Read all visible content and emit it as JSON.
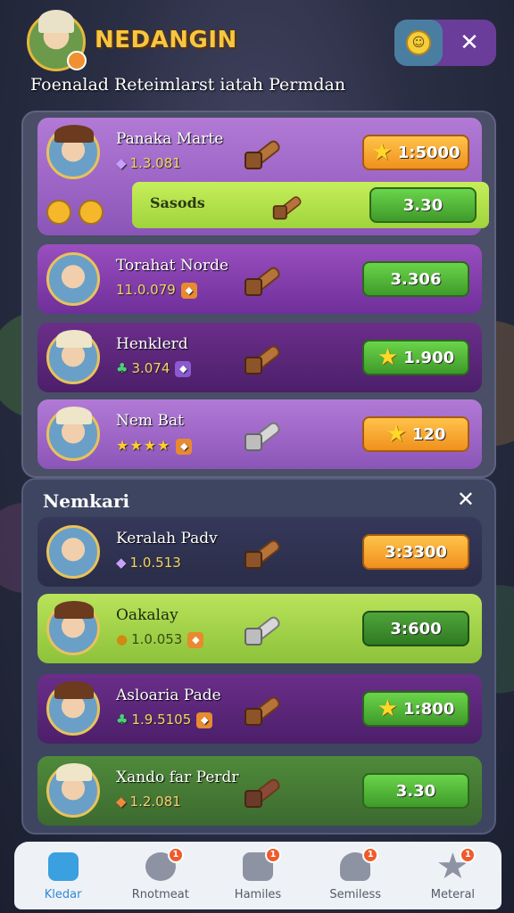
{
  "header": {
    "title": "NEDANGIN",
    "subtitle": "Foenalad Reteimlarst iatah Permdan"
  },
  "top_controls": {
    "close_label": "✕"
  },
  "featured": {
    "name": "Panaka Marte",
    "sub": "1.3.081",
    "button": "1:5000",
    "subrow_label": "Sasods",
    "subrow_button": "3.30"
  },
  "list_a": [
    {
      "name": "Torahat Norde",
      "sub": "11.0.079",
      "button": "3.306",
      "button_style": "green"
    },
    {
      "name": "Henklerd",
      "sub": "3.074",
      "button": "1.900",
      "button_style": "green"
    },
    {
      "name": "Nem Bat",
      "sub": "★★★★",
      "button": "120",
      "button_style": "orange"
    }
  ],
  "section": {
    "title": "Nemkari",
    "close_label": "✕"
  },
  "list_b": [
    {
      "name": "Keralah Padv",
      "sub": "1.0.513",
      "button": "3:3300",
      "button_style": "orange"
    },
    {
      "name": "Oakalay",
      "sub": "1.0.053",
      "button": "3:600",
      "button_style": "dgreen"
    },
    {
      "name": "Asloaria Pade",
      "sub": "1.9.5105",
      "button": "1:800",
      "button_style": "green"
    },
    {
      "name": "Xando far Perdr",
      "sub": "1.2.081",
      "button": "3.30",
      "button_style": "green"
    }
  ],
  "nav": [
    {
      "label": "Kledar",
      "badge": ""
    },
    {
      "label": "Rnotmeat",
      "badge": "1"
    },
    {
      "label": "Hamiles",
      "badge": "1"
    },
    {
      "label": "Semiless",
      "badge": "1"
    },
    {
      "label": "Meteral",
      "badge": "1"
    }
  ]
}
